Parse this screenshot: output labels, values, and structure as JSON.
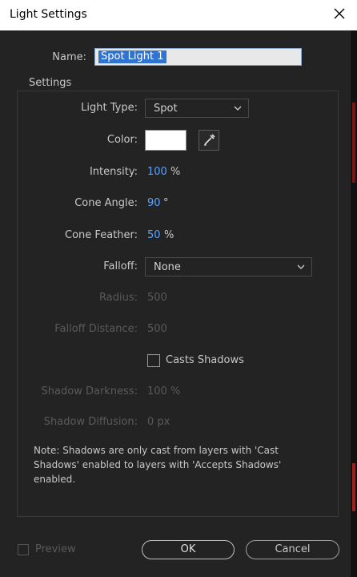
{
  "window": {
    "title": "Light Settings"
  },
  "name": {
    "label": "Name:",
    "value": "Spot Light 1"
  },
  "settings": {
    "group_title": "Settings",
    "light_type": {
      "label": "Light Type:",
      "value": "Spot"
    },
    "color": {
      "label": "Color:",
      "swatch": "#ffffff"
    },
    "intensity": {
      "label": "Intensity:",
      "value": "100",
      "unit": "%"
    },
    "cone_angle": {
      "label": "Cone Angle:",
      "value": "90",
      "unit": "°"
    },
    "cone_feather": {
      "label": "Cone Feather:",
      "value": "50",
      "unit": "%"
    },
    "falloff": {
      "label": "Falloff:",
      "value": "None"
    },
    "radius": {
      "label": "Radius:",
      "value": "500"
    },
    "falloff_distance": {
      "label": "Falloff Distance:",
      "value": "500"
    },
    "casts_shadows": {
      "label": "Casts Shadows",
      "checked": false
    },
    "shadow_darkness": {
      "label": "Shadow Darkness:",
      "value": "100 %"
    },
    "shadow_diffusion": {
      "label": "Shadow Diffusion:",
      "value": "0 px"
    },
    "note": "Note: Shadows are only cast from layers with 'Cast Shadows' enabled to layers with 'Accepts Shadows' enabled."
  },
  "footer": {
    "preview_label": "Preview",
    "ok_label": "OK",
    "cancel_label": "Cancel"
  },
  "colors": {
    "accent_value": "#5aa3ff",
    "selection": "#2f74d0",
    "background": "#232323"
  }
}
